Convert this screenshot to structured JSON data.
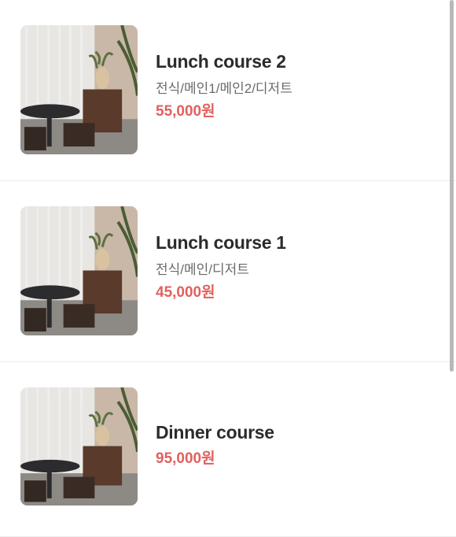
{
  "menu": {
    "items": [
      {
        "name": "Lunch course 2",
        "description": "전식/메인1/메인2/디저트",
        "price": "55,000원"
      },
      {
        "name": "Lunch course 1",
        "description": "전식/메인/디저트",
        "price": "45,000원"
      },
      {
        "name": "Dinner course",
        "description": "",
        "price": "95,000원"
      }
    ]
  },
  "colors": {
    "price": "#e0605e",
    "title": "#2b2b2b",
    "description": "#6b6b6b",
    "divider": "#ececec"
  },
  "icons": [
    "restaurant-interior-photo"
  ]
}
